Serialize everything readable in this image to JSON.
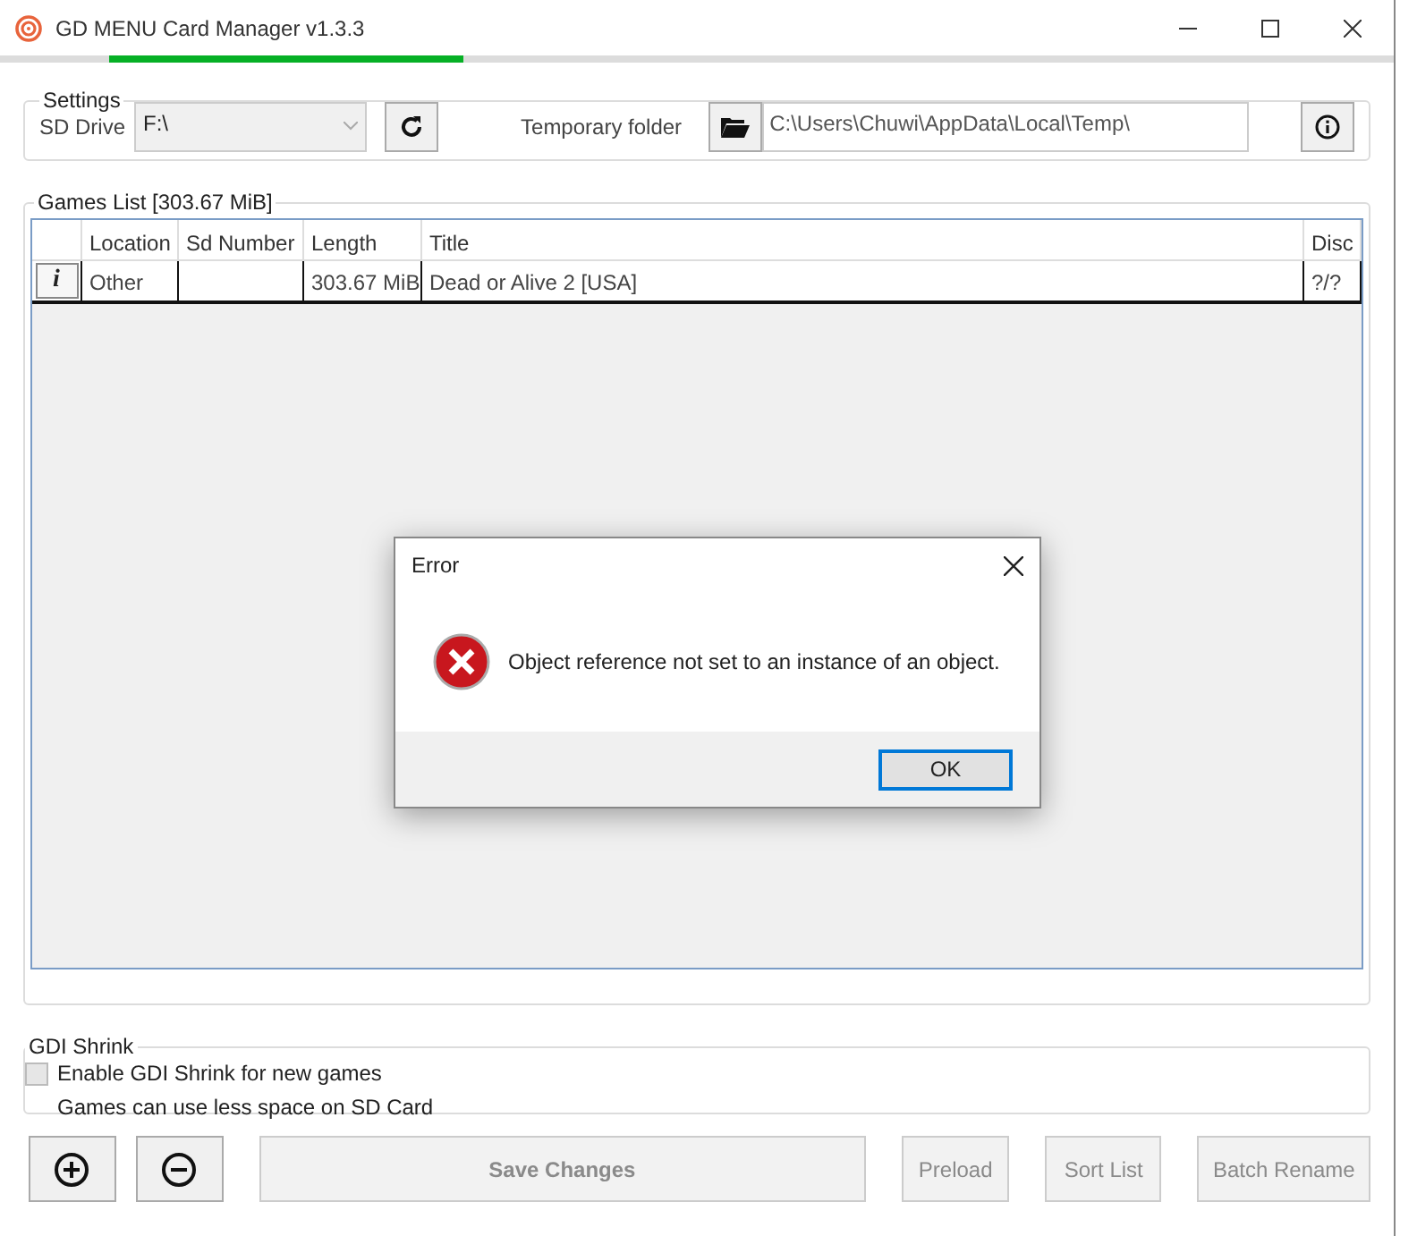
{
  "window": {
    "title": "GD MENU Card Manager v1.3.3"
  },
  "progress": {
    "level": 0.25
  },
  "settings": {
    "title": "Settings",
    "sd_drive_label": "SD Drive",
    "sd_drive_value": "F:\\",
    "temp_folder_label": "Temporary folder",
    "temp_folder_value": "C:\\Users\\Chuwi\\AppData\\Local\\Temp\\"
  },
  "games_list": {
    "title": "Games List [303.67 MiB]",
    "columns": [
      "Location",
      "Sd Number",
      "Length",
      "Title",
      "Disc"
    ],
    "rows": [
      {
        "info": "i",
        "cells": [
          "Other",
          "",
          "303.67 MiB",
          "Dead or Alive 2 [USA]",
          "?/?"
        ]
      }
    ]
  },
  "gdi_shrink": {
    "title": "GDI Shrink",
    "checkbox_label": "Enable GDI Shrink for new games",
    "checked": false,
    "hint": "Games can use less space on SD Card"
  },
  "buttons": [
    {
      "label": "Save Changes",
      "disabled": true
    },
    {
      "label": "Preload",
      "disabled": true
    },
    {
      "label": "Sort List",
      "disabled": true
    },
    {
      "label": "Batch Rename",
      "disabled": true
    }
  ],
  "dialog": {
    "title": "Error",
    "message": "Object reference not set to an instance of an object.",
    "button": "OK"
  }
}
